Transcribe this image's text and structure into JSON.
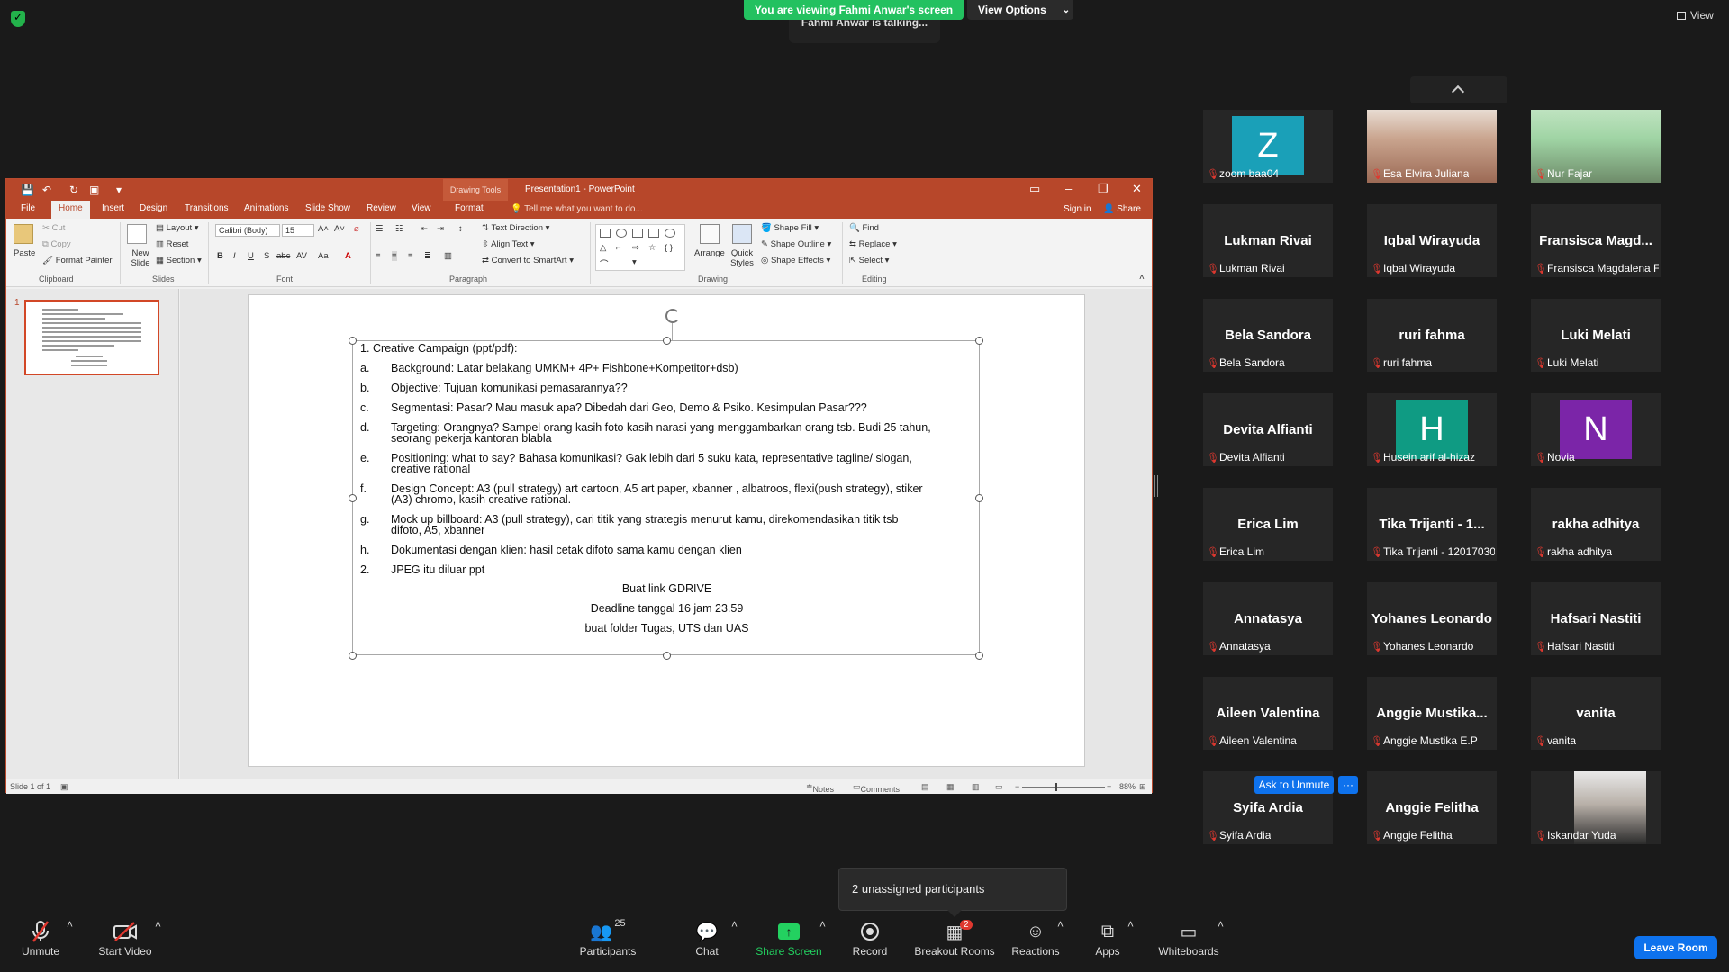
{
  "topbar": {
    "viewing_banner": "You are viewing Fahmi Anwar's screen",
    "view_options": "View Options",
    "talking": "Fahmi Anwar is talking...",
    "view": "View"
  },
  "ppt": {
    "drawing_tools": "Drawing Tools",
    "title": "Presentation1 - PowerPoint",
    "tabs": [
      "File",
      "Home",
      "Insert",
      "Design",
      "Transitions",
      "Animations",
      "Slide Show",
      "Review",
      "View",
      "Format"
    ],
    "tell_me": "Tell me what you want to do...",
    "sign_in": "Sign in",
    "share": "Share",
    "ribbon": {
      "paste": "Paste",
      "cut": "Cut",
      "copy": "Copy",
      "format_painter": "Format Painter",
      "clipboard": "Clipboard",
      "new_slide": "New Slide",
      "layout": "Layout",
      "reset": "Reset",
      "section": "Section",
      "slides": "Slides",
      "font_name": "Calibri (Body)",
      "font_size": "15",
      "font": "Font",
      "text_direction": "Text Direction",
      "align_text": "Align Text",
      "convert_smartart": "Convert to SmartArt",
      "paragraph": "Paragraph",
      "arrange": "Arrange",
      "quick_styles": "Quick Styles",
      "shape_fill": "Shape Fill",
      "shape_outline": "Shape Outline",
      "shape_effects": "Shape Effects",
      "drawing": "Drawing",
      "find": "Find",
      "replace": "Replace",
      "select": "Select",
      "editing": "Editing"
    },
    "slide_lines": [
      {
        "m": "1.",
        "t": "Creative Campaign (ppt/pdf):"
      },
      {
        "m": "a.",
        "t": "Background: Latar belakang UMKM+ 4P+ Fishbone+Kompetitor+dsb)"
      },
      {
        "m": "b.",
        "t": "Objective: Tujuan komunikasi pemasarannya??"
      },
      {
        "m": "c.",
        "t": "Segmentasi: Pasar? Mau masuk apa? Dibedah dari Geo, Demo & Psiko. Kesimpulan Pasar???"
      },
      {
        "m": "d.",
        "t": "Targeting: Orangnya? Sampel orang kasih foto kasih narasi yang menggambarkan orang tsb. Budi 25 tahun,",
        "t2": "seorang pekerja kantoran blabla"
      },
      {
        "m": "e.",
        "t": "Positioning: what to say? Bahasa komunikasi? Gak lebih dari 5 suku kata, representative tagline/ slogan,",
        "t2": "creative rational"
      },
      {
        "m": "f.",
        "t": "Design Concept: A3 (pull strategy) art cartoon, A5 art paper, xbanner , albatroos, flexi(push strategy), stiker",
        "t2": "(A3) chromo, kasih creative rational."
      },
      {
        "m": "g.",
        "t": "Mock up billboard: A3 (pull strategy), cari titik yang strategis menurut kamu, direkomendasikan titik tsb",
        "t2": "difoto, A5, xbanner"
      },
      {
        "m": "h.",
        "t": "Dokumentasi dengan klien: hasil cetak difoto sama kamu dengan klien"
      },
      {
        "m": "2.",
        "t": "JPEG itu diluar ppt"
      }
    ],
    "center_lines": [
      "Buat link GDRIVE",
      "Deadline tanggal 16 jam 23.59",
      "buat folder Tugas, UTS dan UAS"
    ],
    "status": {
      "slide_of": "Slide 1 of 1",
      "notes": "Notes",
      "comments": "Comments",
      "zoom": "88%"
    },
    "thumb_num": "1"
  },
  "participants": [
    {
      "display": "",
      "label": "zoom baa04",
      "avatar": "Z",
      "color": "#1aa0b8"
    },
    {
      "display": "",
      "label": "Esa Elvira Juliana",
      "photo": true
    },
    {
      "display": "",
      "label": "Nur Fajar",
      "photo": true
    },
    {
      "display": "Lukman Rivai",
      "label": "Lukman Rivai"
    },
    {
      "display": "Iqbal Wirayuda",
      "label": "Iqbal Wirayuda"
    },
    {
      "display": "Fransisca  Magd...",
      "label": "Fransisca Magdalena Fo..."
    },
    {
      "display": "Bela Sandora",
      "label": "Bela Sandora"
    },
    {
      "display": "ruri fahma",
      "label": "ruri fahma"
    },
    {
      "display": "Luki Melati",
      "label": "Luki Melati"
    },
    {
      "display": "Devita Alfianti",
      "label": "Devita Alfianti"
    },
    {
      "display": "",
      "label": "Husein arif al-hizaz",
      "avatar": "H",
      "color": "#0f9b83"
    },
    {
      "display": "",
      "label": "Novia",
      "avatar": "N",
      "color": "#7b25a8"
    },
    {
      "display": "Erica Lim",
      "label": "Erica Lim"
    },
    {
      "display": "Tika Trijanti  - 1...",
      "label": "Tika Trijanti  - 12017030..."
    },
    {
      "display": "rakha adhitya",
      "label": "rakha adhitya"
    },
    {
      "display": "Annatasya",
      "label": "Annatasya"
    },
    {
      "display": "Yohanes Leonardo",
      "label": "Yohanes Leonardo"
    },
    {
      "display": "Hafsari Nastiti",
      "label": "Hafsari Nastiti"
    },
    {
      "display": "Aileen Valentina",
      "label": "Aileen Valentina"
    },
    {
      "display": "Anggie  Mustika...",
      "label": "Anggie Mustika E.P"
    },
    {
      "display": "vanita",
      "label": "vanita"
    },
    {
      "display": "Syifa Ardia",
      "label": "Syifa Ardia"
    },
    {
      "display": "Anggie Felitha",
      "label": "Anggie Felitha"
    },
    {
      "display": "",
      "label": "Iskandar Yuda",
      "photo": true
    }
  ],
  "ask_to_unmute": "Ask to Unmute",
  "more": "···",
  "unassigned": "2 unassigned participants",
  "toolbar": {
    "unmute": "Unmute",
    "start_video": "Start Video",
    "participants": "Participants",
    "participants_count": "25",
    "chat": "Chat",
    "share_screen": "Share Screen",
    "record": "Record",
    "breakout_rooms": "Breakout Rooms",
    "breakout_badge": "2",
    "reactions": "Reactions",
    "apps": "Apps",
    "whiteboards": "Whiteboards",
    "leave_room": "Leave Room"
  }
}
